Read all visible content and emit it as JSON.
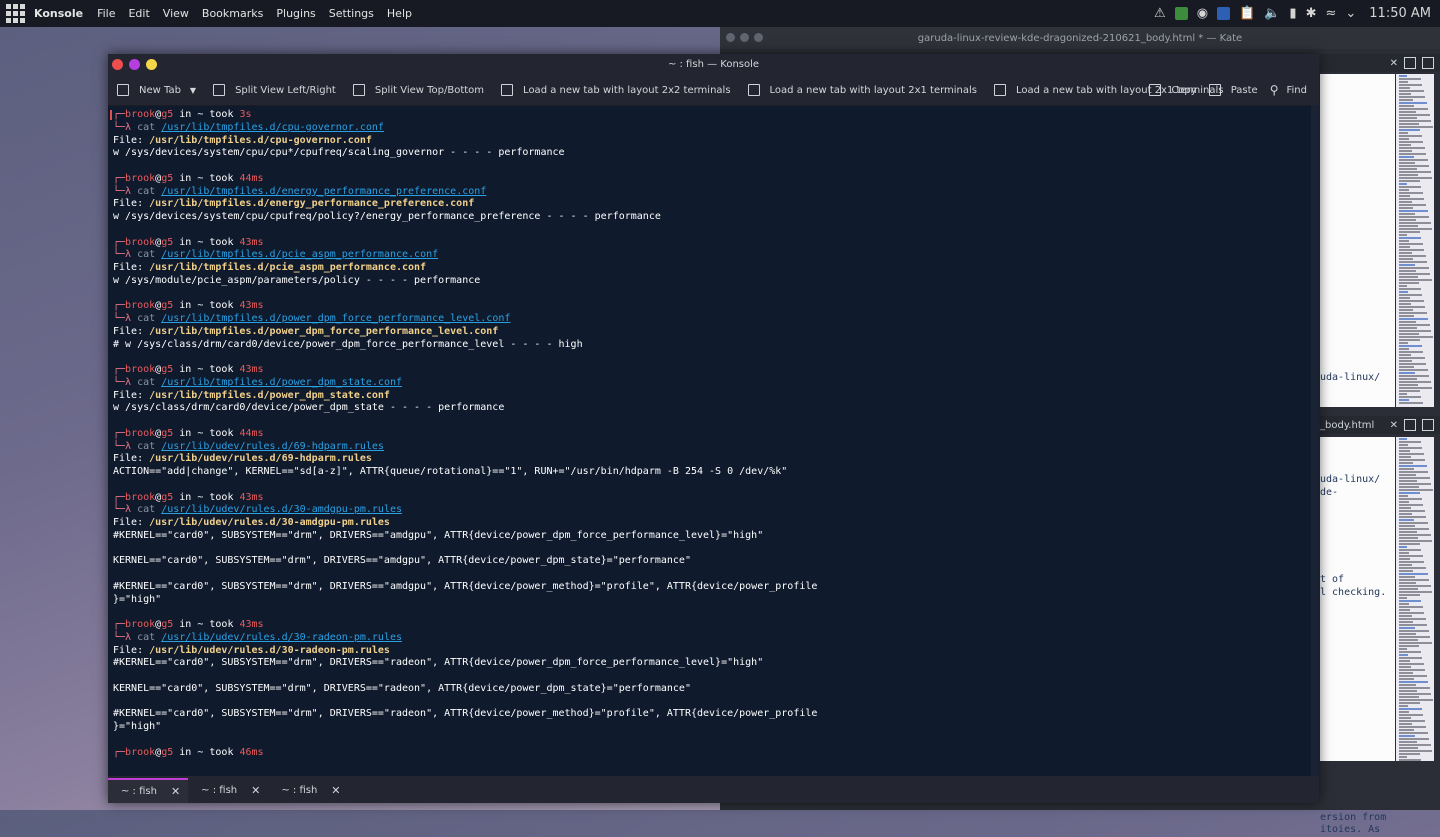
{
  "panel": {
    "app_name": "Konsole",
    "menus": [
      "File",
      "Edit",
      "View",
      "Bookmarks",
      "Plugins",
      "Settings",
      "Help"
    ],
    "clock": "11:50 AM",
    "tray_icons": [
      "notification-icon",
      "updater-icon",
      "steam-icon",
      "konsole-tray-icon",
      "clipboard-icon",
      "volume-icon",
      "battery-icon",
      "bluetooth-icon",
      "wifi-icon",
      "expand-icon"
    ]
  },
  "kate": {
    "title": "garuda-linux-review-kde-dragonized-210621_body.html * — Kate",
    "tab_label": "_body.html",
    "pane_top_lines": [
      "uda-linux/"
    ],
    "pane_bottom_lines": [
      "uda-linux/",
      "de-",
      "",
      "",
      "",
      "",
      "",
      "",
      "t of",
      "l checking.",
      "",
      "",
      "",
      "",
      "",
      "",
      "",
      "",
      "",
      "",
      "",
      "",
      "",
      "",
      "",
      "",
      "",
      "ersion from",
      "itoies. As"
    ]
  },
  "konsole": {
    "title": "~ : fish — Konsole",
    "toolbar": {
      "new_tab": "New Tab",
      "split_lr": "Split View Left/Right",
      "split_tb": "Split View Top/Bottom",
      "layout_2x2": "Load a new tab with layout 2x2 terminals",
      "layout_2x1_a": "Load a new tab with layout 2x1 terminals",
      "layout_2x1_b": "Load a new tab with layout 2x1 terminals",
      "copy": "Copy",
      "paste": "Paste",
      "find": "Find"
    },
    "tabs": [
      "~ : fish",
      "~ : fish",
      "~ : fish"
    ],
    "prompt": {
      "user": "brook",
      "host": "g5",
      "in_word": " in ",
      "dir": "~",
      "took": " took ",
      "cmd": "cat"
    },
    "blocks": [
      {
        "time": "3s",
        "path": "/usr/lib/tmpfiles.d/cpu-governor.conf",
        "output": [
          "w /sys/devices/system/cpu/cpu*/cpufreq/scaling_governor - - - - performance"
        ]
      },
      {
        "time": "44ms",
        "path": "/usr/lib/tmpfiles.d/energy_performance_preference.conf",
        "output": [
          "w /sys/devices/system/cpu/cpufreq/policy?/energy_performance_preference - - - - performance"
        ]
      },
      {
        "time": "43ms",
        "path": "/usr/lib/tmpfiles.d/pcie_aspm_performance.conf",
        "output": [
          "w /sys/module/pcie_aspm/parameters/policy - - - - performance"
        ]
      },
      {
        "time": "43ms",
        "path": "/usr/lib/tmpfiles.d/power_dpm_force_performance_level.conf",
        "output": [
          "# w /sys/class/drm/card0/device/power_dpm_force_performance_level - - - - high"
        ]
      },
      {
        "time": "43ms",
        "path": "/usr/lib/tmpfiles.d/power_dpm_state.conf",
        "output": [
          "w /sys/class/drm/card0/device/power_dpm_state - - - - performance"
        ]
      },
      {
        "time": "44ms",
        "path": "/usr/lib/udev/rules.d/69-hdparm.rules",
        "output": [
          "ACTION==\"add|change\", KERNEL==\"sd[a-z]\", ATTR{queue/rotational}==\"1\", RUN+=\"/usr/bin/hdparm -B 254 -S 0 /dev/%k\""
        ]
      },
      {
        "time": "43ms",
        "path": "/usr/lib/udev/rules.d/30-amdgpu-pm.rules",
        "output": [
          "#KERNEL==\"card0\", SUBSYSTEM==\"drm\", DRIVERS==\"amdgpu\", ATTR{device/power_dpm_force_performance_level}=\"high\"",
          "",
          "KERNEL==\"card0\", SUBSYSTEM==\"drm\", DRIVERS==\"amdgpu\", ATTR{device/power_dpm_state}=\"performance\"",
          "",
          "#KERNEL==\"card0\", SUBSYSTEM==\"drm\", DRIVERS==\"amdgpu\", ATTR{device/power_method}=\"profile\", ATTR{device/power_profile",
          "}=\"high\""
        ]
      },
      {
        "time": "43ms",
        "path": "/usr/lib/udev/rules.d/30-radeon-pm.rules",
        "output": [
          "#KERNEL==\"card0\", SUBSYSTEM==\"drm\", DRIVERS==\"radeon\", ATTR{device/power_dpm_force_performance_level}=\"high\"",
          "",
          "KERNEL==\"card0\", SUBSYSTEM==\"drm\", DRIVERS==\"radeon\", ATTR{device/power_dpm_state}=\"performance\"",
          "",
          "#KERNEL==\"card0\", SUBSYSTEM==\"drm\", DRIVERS==\"radeon\", ATTR{device/power_method}=\"profile\", ATTR{device/power_profile",
          "}=\"high\""
        ]
      }
    ],
    "last_time": "46ms",
    "file_label": "File: "
  },
  "colors": {
    "accent": "#c23dd1",
    "close_dot": "#ed4e4e",
    "min_dot": "#b63ee0",
    "max_dot": "#f5d54a"
  }
}
